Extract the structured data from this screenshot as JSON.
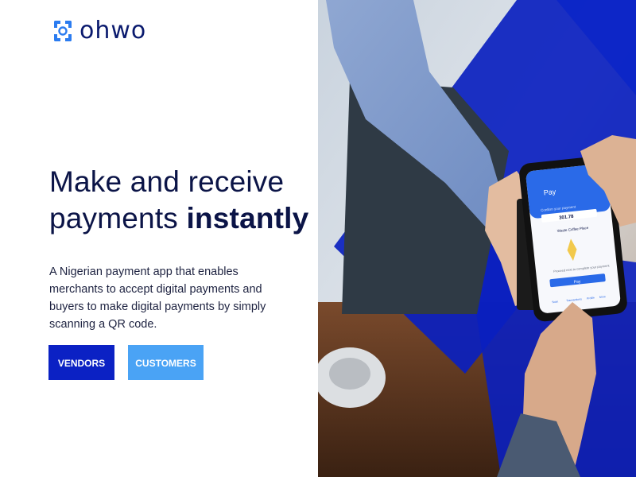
{
  "brand": {
    "name": "ohwo",
    "logo_icon": "ohwo-logo-icon"
  },
  "hero": {
    "headline_line1": "Make and receive",
    "headline_line2_normal": "payments",
    "headline_line2_bold": "instantly",
    "description": "A Nigerian payment app that enables merchants to accept digital payments and buyers to make digital payments by simply scanning a QR code."
  },
  "buttons": {
    "vendors": "VENDORS",
    "customers": "CUSTOMERS"
  },
  "phone": {
    "confirm_label": "Confirm your payment",
    "amount": "301.78",
    "merchant": "Waste Coffee Place",
    "tip": "Proceed next to complete your payment",
    "pay_button": "Pay",
    "nav": [
      "Scan",
      "Transactions",
      "Profile",
      "More"
    ]
  },
  "colors": {
    "brand_dark": "#0b21c4",
    "brand_light": "#4aa3f5",
    "text": "#0b1447"
  }
}
